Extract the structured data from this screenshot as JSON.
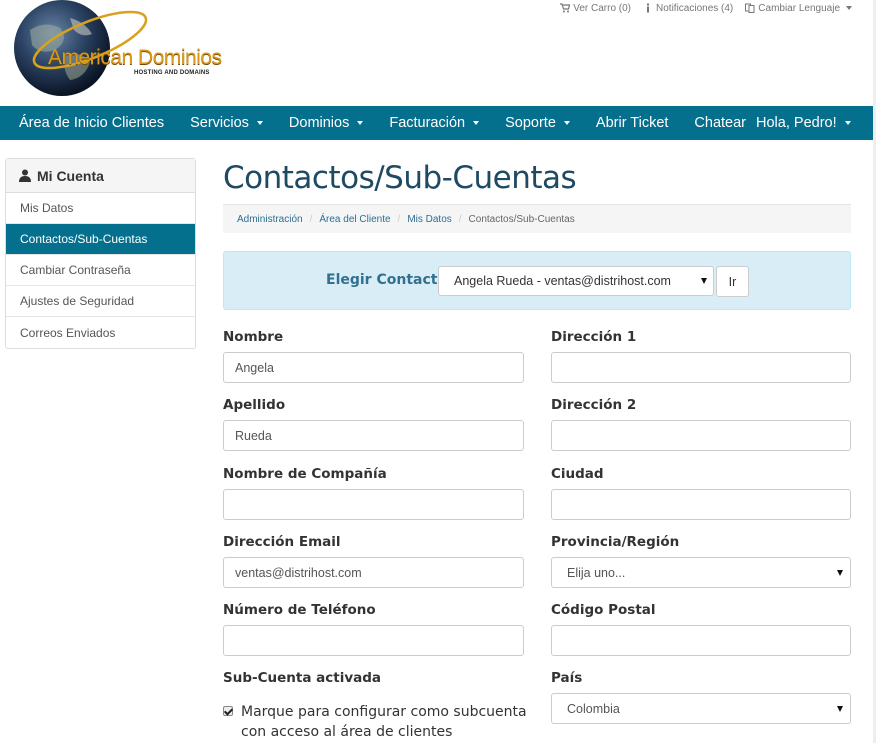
{
  "topbar": {
    "cart": "Ver Carro (0)",
    "notifications": "Notificaciones (4)",
    "language": "Cambiar Lenguaje"
  },
  "logo": {
    "title": "American Dominios",
    "subtitle": "HOSTING AND DOMAINS"
  },
  "navbar": {
    "items": [
      {
        "label": "Área de Inicio Clientes",
        "dropdown": false
      },
      {
        "label": "Servicios",
        "dropdown": true
      },
      {
        "label": "Dominios",
        "dropdown": true
      },
      {
        "label": "Facturación",
        "dropdown": true
      },
      {
        "label": "Soporte",
        "dropdown": true
      },
      {
        "label": "Abrir Ticket",
        "dropdown": false
      },
      {
        "label": "Chatear",
        "dropdown": false
      }
    ],
    "user": "Hola, Pedro!"
  },
  "sidebar": {
    "title": "Mi Cuenta",
    "items": [
      {
        "label": "Mis Datos",
        "active": false
      },
      {
        "label": "Contactos/Sub-Cuentas",
        "active": true
      },
      {
        "label": "Cambiar Contraseña",
        "active": false
      },
      {
        "label": "Ajustes de Seguridad",
        "active": false
      },
      {
        "label": "Correos Enviados",
        "active": false
      }
    ]
  },
  "main": {
    "title": "Contactos/Sub-Cuentas",
    "breadcrumb": [
      "Administración",
      "Área del Cliente",
      "Mis Datos",
      "Contactos/Sub-Cuentas"
    ],
    "choose": {
      "label": "Elegir Contacto",
      "selected": "Angela Rueda - ventas@distrihost.com",
      "button": "Ir"
    },
    "form": {
      "nombre": {
        "label": "Nombre",
        "value": "Angela"
      },
      "apellido": {
        "label": "Apellido",
        "value": "Rueda"
      },
      "compania": {
        "label": "Nombre de Compañía",
        "value": ""
      },
      "email": {
        "label": "Dirección Email",
        "value": "ventas@distrihost.com"
      },
      "telefono": {
        "label": "Número de Teléfono",
        "value": ""
      },
      "subcuenta": {
        "label": "Sub-Cuenta activada",
        "checkbox_text": "Marque para configurar como subcuenta con acceso al área de clientes",
        "checked": true
      },
      "direccion1": {
        "label": "Dirección 1",
        "value": ""
      },
      "direccion2": {
        "label": "Dirección 2",
        "value": ""
      },
      "ciudad": {
        "label": "Ciudad",
        "value": ""
      },
      "provincia": {
        "label": "Provincia/Región",
        "value": "Elija uno..."
      },
      "codigo_postal": {
        "label": "Código Postal",
        "value": ""
      },
      "pais": {
        "label": "País",
        "value": "Colombia"
      }
    }
  },
  "colors": {
    "primary": "#05708e",
    "title": "#1f4a63",
    "info_bg": "#d9edf7",
    "info_text": "#31708f"
  }
}
